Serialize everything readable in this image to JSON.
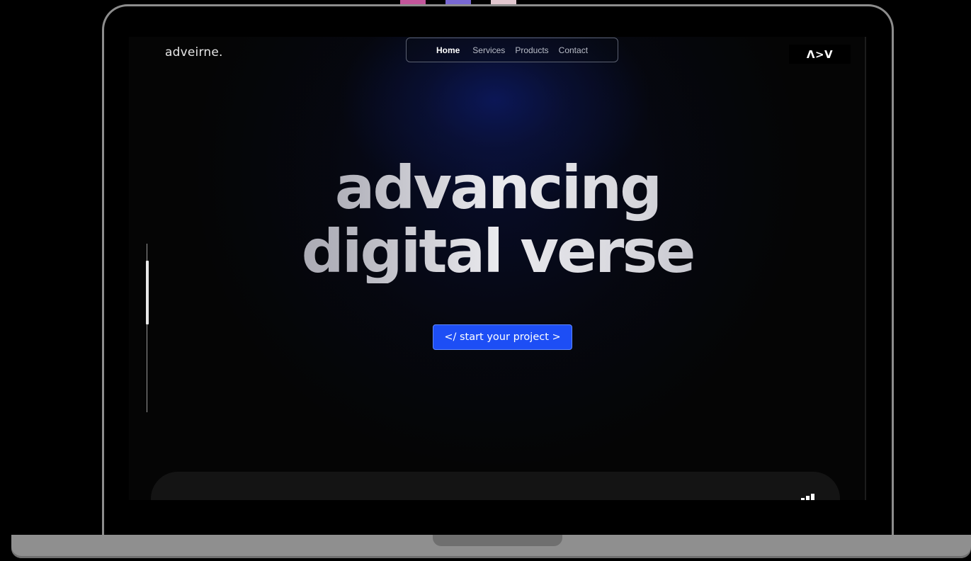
{
  "site": {
    "brand": "adveirne.",
    "logo_badge": "Λ>V"
  },
  "nav": {
    "items": [
      {
        "label": "Home",
        "active": true
      },
      {
        "label": "Services",
        "active": false
      },
      {
        "label": "Products",
        "active": false
      },
      {
        "label": "Contact",
        "active": false
      }
    ]
  },
  "hero": {
    "line1": "advancing",
    "line2": "digital verse",
    "cta_label": "</ start your project >"
  },
  "icons": {
    "bottom_card_icon": "bars-icon"
  },
  "colors": {
    "accent": "#1d4ef5",
    "background": "#050505",
    "glow": "#0c185c"
  }
}
